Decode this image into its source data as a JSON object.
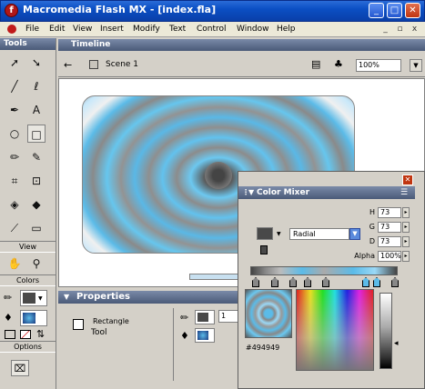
{
  "window": {
    "title": "Macromedia Flash MX - [index.fla]",
    "app_icon_glyph": "f",
    "controls": {
      "minimize": "_",
      "maximize": "□",
      "close": "✕"
    }
  },
  "menubar": {
    "items": [
      "File",
      "Edit",
      "View",
      "Insert",
      "Modify",
      "Text",
      "Control",
      "Window",
      "Help"
    ],
    "mdi": {
      "minimize": "_",
      "restore": "▫",
      "close": "x"
    }
  },
  "tools": {
    "title": "Tools",
    "items": [
      {
        "name": "arrow-tool",
        "icon": "arrow-icon",
        "glyph": "➚"
      },
      {
        "name": "subselect-tool",
        "icon": "subselect-icon",
        "glyph": "➘"
      },
      {
        "name": "line-tool",
        "icon": "line-icon",
        "glyph": "╱"
      },
      {
        "name": "lasso-tool",
        "icon": "lasso-icon",
        "glyph": "ℓ"
      },
      {
        "name": "pen-tool",
        "icon": "pen-icon",
        "glyph": "✒"
      },
      {
        "name": "text-tool",
        "icon": "text-icon",
        "glyph": "A"
      },
      {
        "name": "oval-tool",
        "icon": "oval-icon",
        "glyph": "○"
      },
      {
        "name": "rectangle-tool",
        "icon": "rectangle-icon",
        "glyph": "□"
      },
      {
        "name": "pencil-tool",
        "icon": "pencil-icon",
        "glyph": "✏"
      },
      {
        "name": "brush-tool",
        "icon": "brush-icon",
        "glyph": "✎"
      },
      {
        "name": "free-transform-tool",
        "icon": "free-transform-icon",
        "glyph": "⌗"
      },
      {
        "name": "fill-transform-tool",
        "icon": "fill-transform-icon",
        "glyph": "⊡"
      },
      {
        "name": "ink-bottle-tool",
        "icon": "ink-bottle-icon",
        "glyph": "◈"
      },
      {
        "name": "paint-bucket-tool",
        "icon": "paint-bucket-icon",
        "glyph": "◆"
      },
      {
        "name": "eyedropper-tool",
        "icon": "eyedropper-icon",
        "glyph": "⟋"
      },
      {
        "name": "eraser-tool",
        "icon": "eraser-icon",
        "glyph": "▭"
      }
    ],
    "view_label": "View",
    "view_items": [
      {
        "name": "hand-tool",
        "icon": "hand-icon",
        "glyph": "✋"
      },
      {
        "name": "zoom-tool",
        "icon": "zoom-icon",
        "glyph": "⚲"
      }
    ],
    "colors_label": "Colors",
    "options_label": "Options"
  },
  "timeline": {
    "label": "Timeline",
    "scene": "Scene 1",
    "zoom": "100%"
  },
  "artwork": {
    "rings": [
      "#7e7e7e",
      "#9a9a9a",
      "#c8e8fa",
      "#f0f0f0",
      "#5bbbe8",
      "#8a8a8a",
      "#66c6ee",
      "#939393",
      "#5ab8e6",
      "#8f8f8f",
      "#62c2ee",
      "#8c8c8c",
      "#6cc8f0",
      "#5a5a5a"
    ]
  },
  "properties": {
    "label": "Properties",
    "tool_type": "Rectangle",
    "tool_sub": "Tool",
    "stroke_height": "1"
  },
  "mixer": {
    "label": "Color Mixer",
    "fill_type": "Radial",
    "h_label": "H",
    "h_value": "73",
    "g_label": "G",
    "g_value": "73",
    "d_label": "D",
    "d_value": "73",
    "alpha_label": "Alpha",
    "alpha_value": "100%",
    "hex": "#494949",
    "colors": {
      "accent": "#5bbbe8",
      "gray": "#494949"
    }
  }
}
